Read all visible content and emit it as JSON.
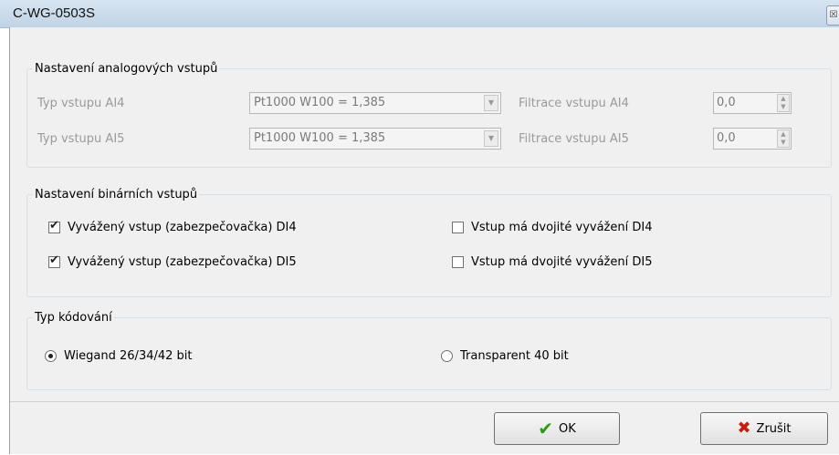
{
  "window": {
    "title": "C-WG-0503S",
    "close_glyph": "☒"
  },
  "analog": {
    "legend": "Nastavení analogových vstupů",
    "rows": [
      {
        "type_label": "Typ vstupu AI4",
        "combo_value": "Pt1000 W100 = 1,385",
        "filter_label": "Filtrace vstupu AI4",
        "filter_value": "0,0"
      },
      {
        "type_label": "Typ vstupu AI5",
        "combo_value": "Pt1000 W100 = 1,385",
        "filter_label": "Filtrace vstupu AI5",
        "filter_value": "0,0"
      }
    ]
  },
  "binary": {
    "legend": "Nastavení binárních vstupů",
    "items": [
      {
        "label": "Vyvážený vstup (zabezpečovačka) DI4",
        "checked": true
      },
      {
        "label": "Vyvážený vstup (zabezpečovačka) DI5",
        "checked": true
      },
      {
        "label": "Vstup má dvojité vyvážení DI4",
        "checked": false
      },
      {
        "label": "Vstup má dvojité vyvážení DI5",
        "checked": false
      }
    ]
  },
  "coding": {
    "legend": "Typ kódování",
    "options": [
      {
        "label": "Wiegand 26/34/42 bit",
        "selected": true
      },
      {
        "label": "Transparent 40 bit",
        "selected": false
      }
    ]
  },
  "buttons": {
    "ok_label": "OK",
    "cancel_label": "Zrušit"
  },
  "icons": {
    "ok": "check-icon",
    "cancel": "x-icon",
    "close": "close-icon"
  },
  "colors": {
    "ok_icon": "#2f9a1a",
    "cancel_icon": "#c4200f"
  }
}
